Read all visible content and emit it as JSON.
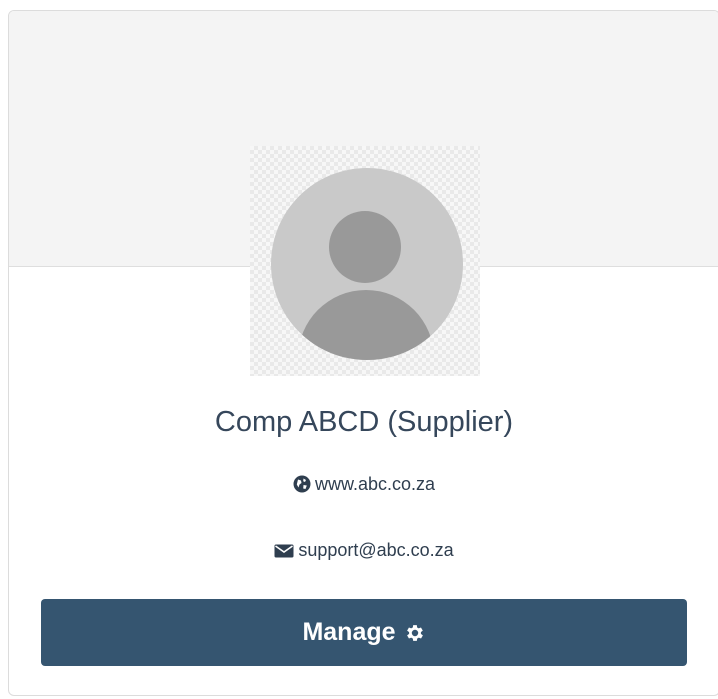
{
  "profile": {
    "name": "Comp ABCD (Supplier)",
    "website": "www.abc.co.za",
    "email": "support@abc.co.za",
    "avatar_icon": "default-user-avatar"
  },
  "actions": {
    "manage_label": "Manage",
    "manage_icon": "gear-icon"
  },
  "colors": {
    "button_bg": "#355570",
    "title_text": "#36475b",
    "cover_bg": "#f4f4f4"
  }
}
